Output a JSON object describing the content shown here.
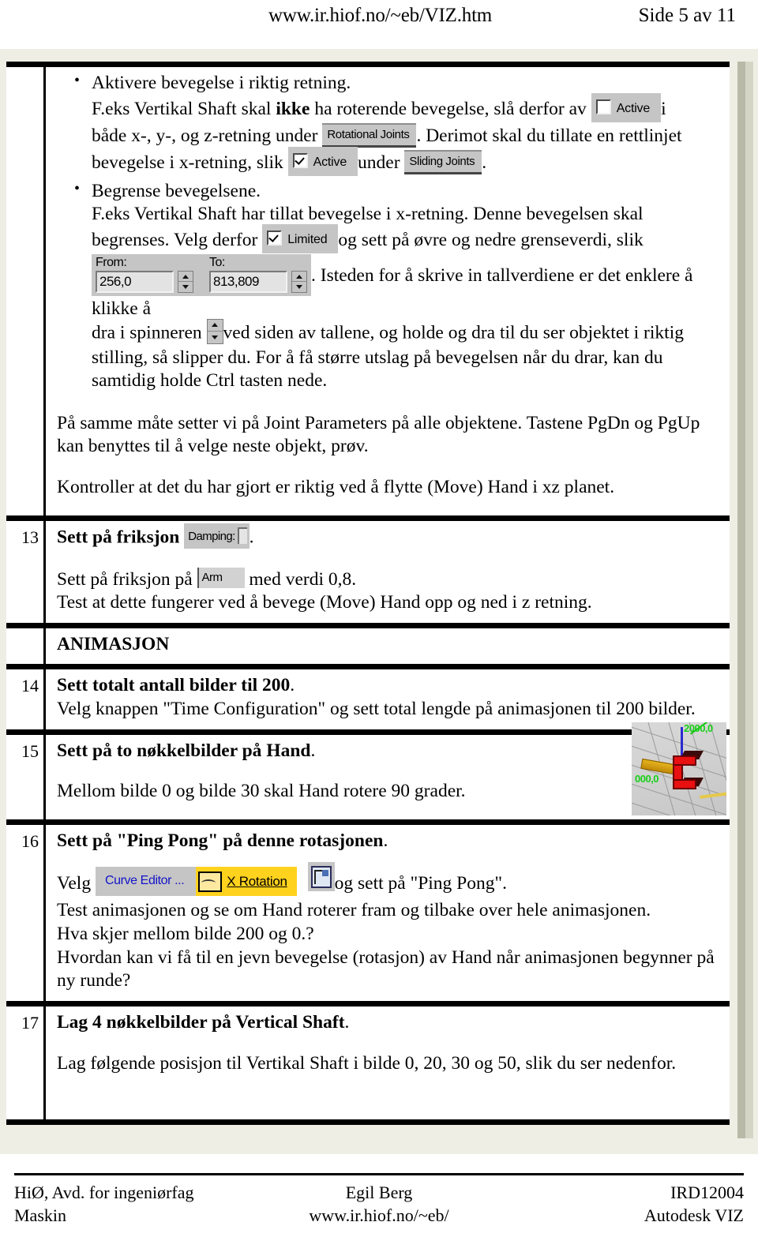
{
  "header": {
    "url": "www.ir.hiof.no/~eb/VIZ.htm",
    "page_label": "Side 5 av 11"
  },
  "content": {
    "bullets": [
      {
        "title": "Aktivere bevegelse i riktig retning.",
        "line1_a": "F.eks Vertikal Shaft skal ",
        "line1_bold": "ikke",
        "line1_b": " ha roterende bevegelse, slå derfor av ",
        "line1_c": "i",
        "line2_a": "både x-, y-, og z-retning under ",
        "line2_b": ". Derimot skal du tillate en rettlinjet",
        "line3_a": "bevegelse i x-retning, slik ",
        "line3_b": "under ",
        "line3_c": "."
      },
      {
        "title": "Begrense bevegelsene.",
        "line1": "F.eks Vertikal Shaft har tillat bevegelse i x-retning. Denne bevegelsen skal",
        "line2_a": "begrenses. Velg derfor ",
        "line2_b": "og sett på øvre og nedre grenseverdi, slik",
        "line3_b": ". Isteden for å skrive in tallverdiene er det enklere å klikke å",
        "line4_a": "dra i spinneren ",
        "line4_b": "ved siden av tallene, og holde og dra til du ser objektet i riktig",
        "line5": "stilling, så slipper du. For å få større utslag på bevegelsen når du drar, kan du",
        "line6": "samtidig holde Ctrl tasten nede."
      }
    ],
    "para_joint_1": "På samme måte setter vi på Joint Parameters på alle objektene. Tastene  PgDn og PgUp",
    "para_joint_2": "kan benyttes til å velge neste objekt, prøv.",
    "para_control": "Kontroller at det du har gjort er riktig ved å flytte (Move) Hand i xz planet."
  },
  "widgets": {
    "active_off": {
      "label": "Active",
      "checked": false
    },
    "active_on": {
      "label": "Active",
      "checked": true
    },
    "rotational_joints": "Rotational Joints",
    "sliding_joints": "Sliding Joints",
    "limited": {
      "label": "Limited",
      "checked": true
    },
    "from_to": {
      "from_caption": "From:",
      "from_value": "256,0",
      "to_caption": "To:",
      "to_value": "813,809"
    },
    "damping": {
      "label": "Damping:"
    },
    "arm": {
      "label": "Arm"
    },
    "curve_editor": {
      "label": "Curve Editor ..."
    },
    "x_rotation": {
      "label": "X Rotation"
    }
  },
  "viewport": {
    "label_top": "2000,0",
    "label_left": "000,0"
  },
  "items": [
    {
      "number": "13",
      "title_a": "Sett på friksjon ",
      "title_b": ".",
      "body_a": "Sett på friksjon på ",
      "body_b": " med verdi 0,8.",
      "body_line2": "Test at dette fungerer ved å bevege (Move) Hand opp og ned i z retning."
    },
    {
      "number": "",
      "title_a": "ANIMASJON",
      "title_b": "",
      "body_a": "",
      "body_b": "",
      "body_line2": ""
    },
    {
      "number": "14",
      "title_a": "Sett totalt antall bilder til 200",
      "title_b": ".",
      "body_line2": "Velg knappen \"Time Configuration\" og sett total lengde på animasjonen til 200 bilder."
    },
    {
      "number": "15",
      "title_a": "Sett på to nøkkelbilder på Hand",
      "title_b": ".",
      "body_line2": "Mellom bilde 0 og bilde 30 skal Hand rotere 90 grader."
    },
    {
      "number": "16",
      "title_a": "Sett på \"Ping Pong\" på denne rotasjonen",
      "title_b": ".",
      "velg_label": "Velg",
      "body_tail": "og sett på \"Ping Pong\".",
      "line2": "Test animasjonen og se om Hand roterer fram og tilbake over hele animasjonen.",
      "line3": "Hva skjer mellom bilde 200 og 0.?",
      "line4": "Hvordan kan vi få til en jevn bevegelse (rotasjon) av Hand når animasjonen begynner på",
      "line5": "ny runde?"
    },
    {
      "number": "17",
      "title_a": "Lag 4 nøkkelbilder på Vertical Shaft",
      "title_b": ".",
      "body_line2": "Lag følgende posisjon til Vertikal Shaft i bilde 0, 20, 30 og 50,  slik du ser nedenfor."
    }
  ],
  "footer": {
    "left_1": "HiØ, Avd. for ingeniørfag",
    "left_2": "Maskin",
    "center_1": "Egil Berg",
    "center_2": "www.ir.hiof.no/~eb/",
    "right_1": "IRD12004",
    "right_2": "Autodesk VIZ"
  }
}
